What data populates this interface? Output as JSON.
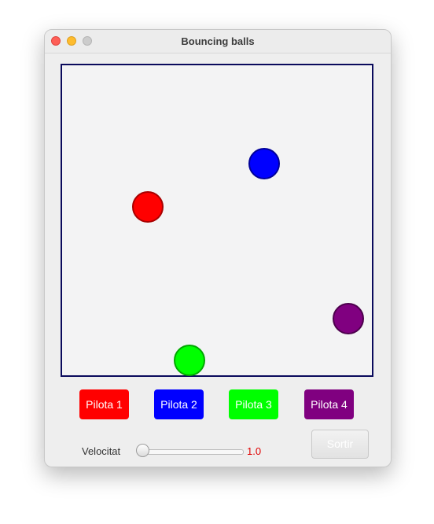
{
  "window": {
    "title": "Bouncing balls"
  },
  "balls": [
    {
      "name": "Pilota 1",
      "color": "#ff0000"
    },
    {
      "name": "Pilota 2",
      "color": "#0000ff"
    },
    {
      "name": "Pilota 3",
      "color": "#00ff00"
    },
    {
      "name": "Pilota 4",
      "color": "#800080"
    }
  ],
  "controls": {
    "speed_label": "Velocitat",
    "speed_value": "1.0",
    "speed_fraction": 0.0,
    "exit_label": "Sortir"
  },
  "colors": {
    "court_border": "#0a0a5c",
    "speed_value": "#e00000"
  }
}
